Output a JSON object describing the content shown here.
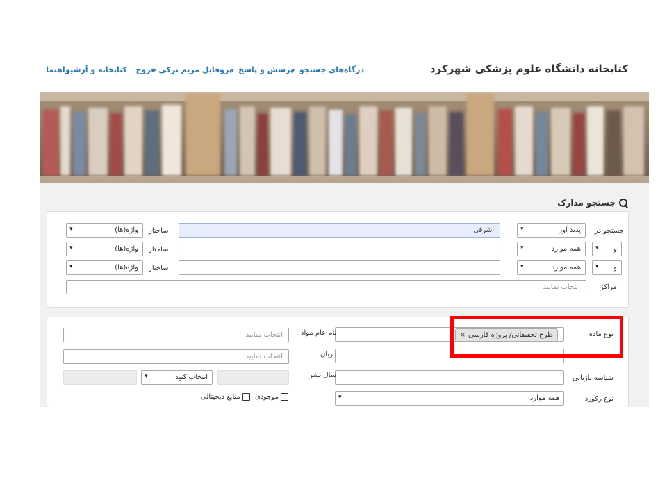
{
  "header": {
    "brand": "کتابخانه دانشگاه علوم پزشکی شهرکرد",
    "nav": [
      {
        "label": "درگاه‌های جستجو",
        "caret": "▾"
      },
      {
        "label": "پرسش و پاسخ",
        "caret": "▾"
      },
      {
        "label": "پروفایل مریم ترکی",
        "caret": "▾"
      },
      {
        "label": "خروج",
        "caret": ""
      },
      {
        "label": "کتابخانه و آرشیو",
        "caret": ""
      },
      {
        "label": "راهنما",
        "caret": ""
      }
    ]
  },
  "panel": {
    "title": "جستجو مدارک"
  },
  "search_box": {
    "search_in_label": "جستجو در",
    "rows": [
      {
        "operator": "",
        "field": "پدید آور",
        "value": "اشرفی",
        "structure_label": "ساختار",
        "structure": "واژه(ها)"
      },
      {
        "operator": "و",
        "field": "همه موارد",
        "value": "",
        "structure_label": "ساختار",
        "structure": "واژه(ها)"
      },
      {
        "operator": "و",
        "field": "همه موارد",
        "value": "",
        "structure_label": "ساختار",
        "structure": "واژه(ها)"
      }
    ],
    "centers_label": "مراکز",
    "centers_placeholder": "انتخاب نمایید"
  },
  "filters": {
    "material_type_label": "نوع ماده",
    "material_type_tag": "طرح تحقیقاتی/ پروژه فارسی",
    "general_material_label": "نام عام مواد",
    "general_material_placeholder": "انتخاب نمایید",
    "language_label": "زبان",
    "language_placeholder": "انتخاب نمایید",
    "retrieval_id_label": "شناسه بازیابی",
    "publish_year_label": "سال نشر",
    "publish_year_select": "انتخاب کنید",
    "record_type_label": "نوع رکورد",
    "record_type_value": "همه موارد",
    "availability_label": "موجودی",
    "digital_label": "منابع دیجیتالی"
  },
  "colors": {
    "link": "#2a7ab0",
    "highlight_frame": "#ff0000",
    "filled_input": "#e6eefb"
  }
}
